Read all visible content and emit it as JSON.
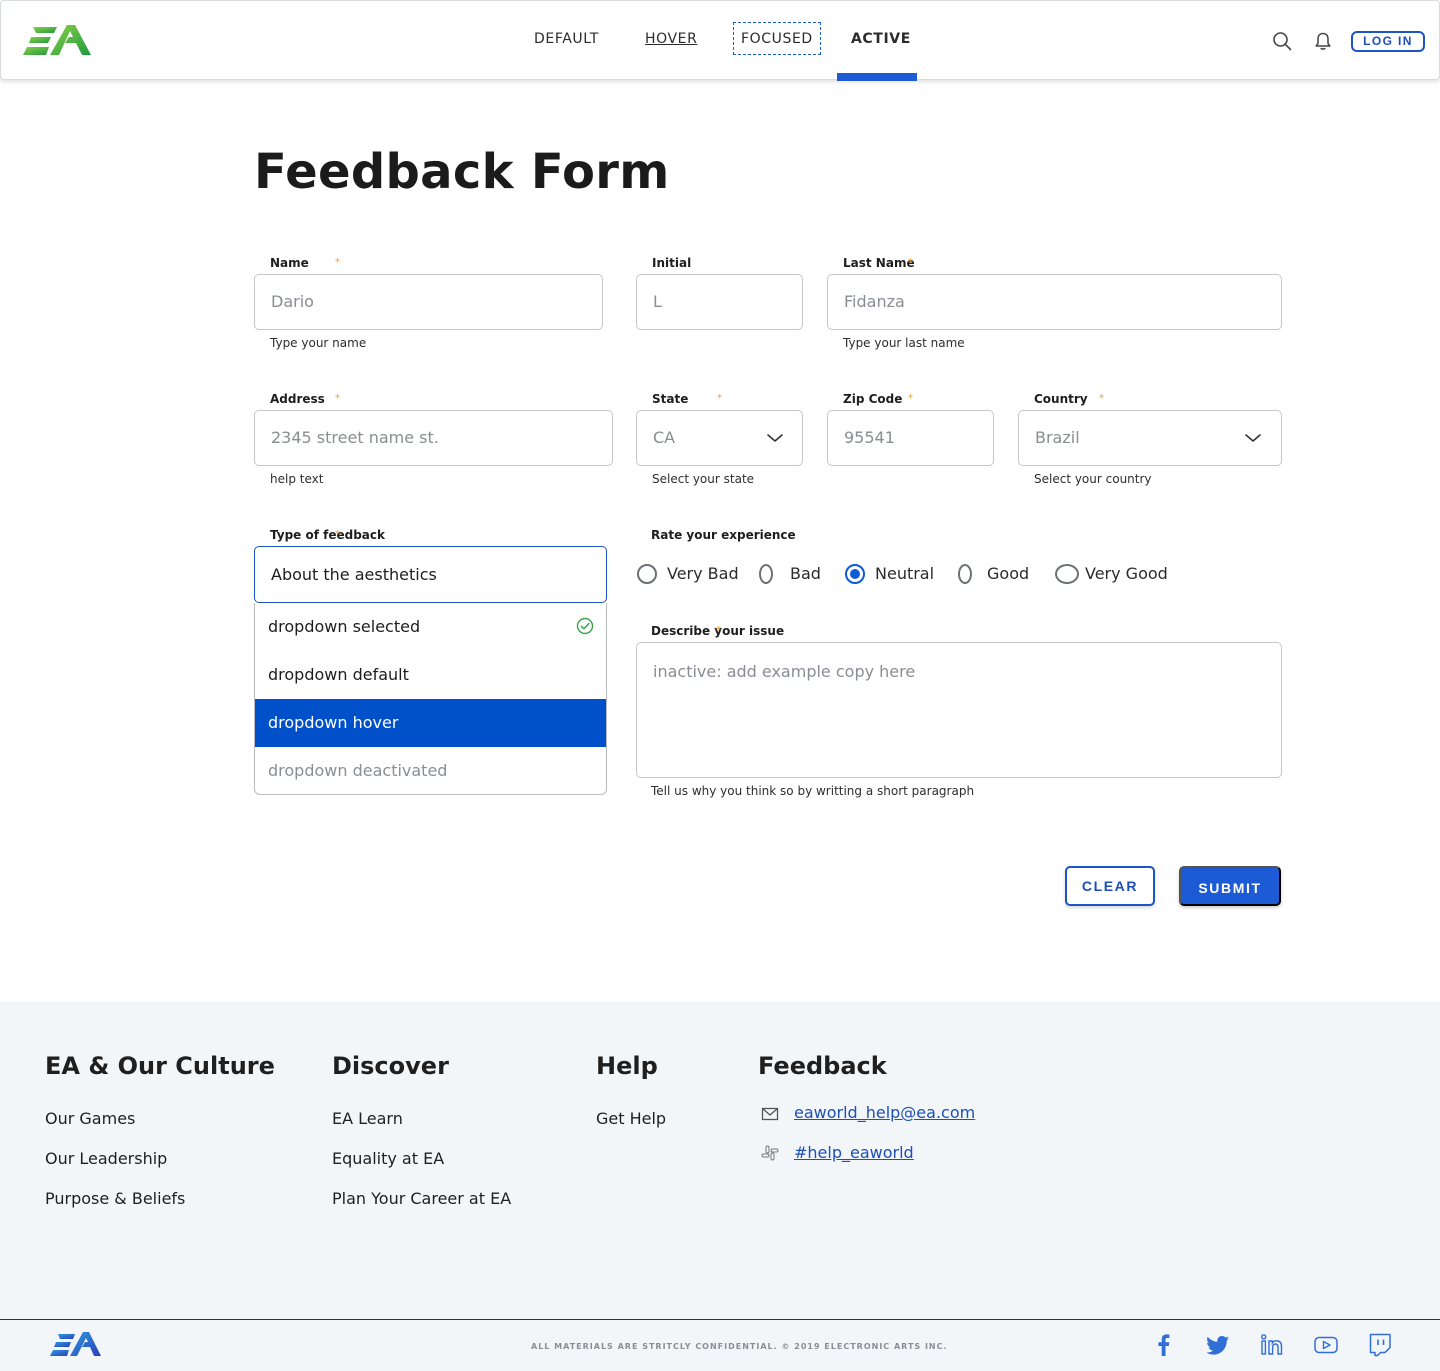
{
  "header": {
    "nav": [
      {
        "label": "DEFAULT"
      },
      {
        "label": "HOVER"
      },
      {
        "label": "FOCUSED"
      },
      {
        "label": "ACTIVE"
      }
    ],
    "login_label": "LOG IN"
  },
  "form": {
    "title": "Feedback Form",
    "name": {
      "label": "Name",
      "value": "Dario",
      "help": "Type your name"
    },
    "initial": {
      "label": "Initial",
      "value": "L"
    },
    "last_name": {
      "label": "Last Name",
      "value": "Fidanza",
      "help": "Type your last name"
    },
    "address": {
      "label": "Address",
      "value": "2345 street name st.",
      "help": "help text"
    },
    "state": {
      "label": "State",
      "value": "CA",
      "help": "Select your state"
    },
    "zip": {
      "label": "Zip Code",
      "value": "95541"
    },
    "country": {
      "label": "Country",
      "value": "Brazil",
      "help": "Select your country"
    },
    "feedback_type": {
      "label": "Type of feedback",
      "value": "About the aesthetics",
      "options": [
        {
          "label": "dropdown selected"
        },
        {
          "label": "dropdown default"
        },
        {
          "label": "dropdown hover"
        },
        {
          "label": "dropdown deactivated"
        }
      ]
    },
    "rating": {
      "label": "Rate your experience",
      "options": [
        {
          "label": "Very Bad"
        },
        {
          "label": "Bad"
        },
        {
          "label": "Neutral"
        },
        {
          "label": "Good"
        },
        {
          "label": "Very Good"
        }
      ],
      "selected": "Neutral"
    },
    "issue": {
      "label": "Describe your issue",
      "placeholder": "inactive: add example copy here",
      "help": "Tell us why you think so by writting a short paragraph"
    },
    "required_mark": "*",
    "clear_label": "CLEAR",
    "submit_label": "SUBMIT"
  },
  "footer": {
    "columns": [
      {
        "heading": "EA & Our Culture",
        "links": [
          "Our Games",
          "Our Leadership",
          "Purpose & Beliefs"
        ]
      },
      {
        "heading": "Discover",
        "links": [
          "EA Learn",
          "Equality at EA",
          "Plan Your Career at EA"
        ]
      },
      {
        "heading": "Help",
        "links": [
          "Get Help"
        ]
      },
      {
        "heading": "Feedback",
        "contacts": [
          {
            "icon": "mail-icon",
            "text": "eaworld_help@ea.com"
          },
          {
            "icon": "slack-icon",
            "text": "#help_eaworld"
          }
        ]
      }
    ],
    "copyright": "ALL MATERIALS ARE STRITCLY CONFIDENTIAL. © 2019 ELECTRONIC ARTS INC.",
    "social_icons": [
      "facebook-icon",
      "twitter-icon",
      "linkedin-icon",
      "youtube-icon",
      "twitch-icon"
    ]
  },
  "colors": {
    "accent": "#1d5bd6",
    "dropdown_hover": "#0051c9",
    "footer_bg": "#f3f6f9",
    "required": "#f0a020",
    "logo_green": "#3fae3f"
  }
}
